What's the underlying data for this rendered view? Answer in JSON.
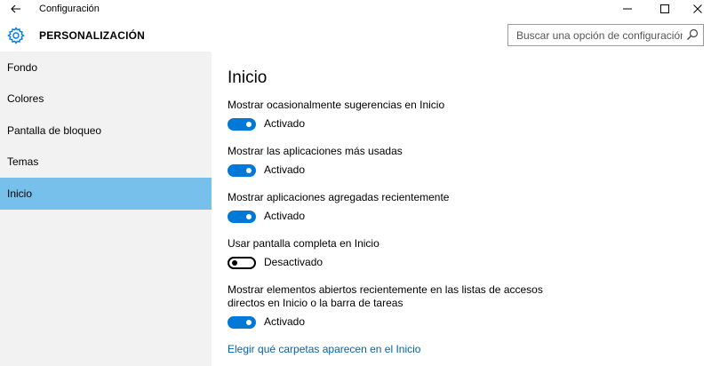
{
  "titlebar": {
    "app_title": "Configuración",
    "icons": {
      "back": "back-arrow-icon",
      "minimize": "minimize-icon",
      "maximize": "maximize-icon",
      "close": "close-icon"
    }
  },
  "header": {
    "section_title": "PERSONALIZACIÓN",
    "section_icon": "gear-icon",
    "search_placeholder": "Buscar una opción de configuración",
    "search_icon": "search-icon"
  },
  "sidebar": {
    "items": [
      {
        "label": "Fondo",
        "selected": false
      },
      {
        "label": "Colores",
        "selected": false
      },
      {
        "label": "Pantalla de bloqueo",
        "selected": false
      },
      {
        "label": "Temas",
        "selected": false
      },
      {
        "label": "Inicio",
        "selected": true
      }
    ]
  },
  "main": {
    "title": "Inicio",
    "settings": [
      {
        "label": "Mostrar ocasionalmente sugerencias en Inicio",
        "state": "Activado",
        "on": true
      },
      {
        "label": "Mostrar las aplicaciones más usadas",
        "state": "Activado",
        "on": true
      },
      {
        "label": "Mostrar aplicaciones agregadas recientemente",
        "state": "Activado",
        "on": true
      },
      {
        "label": "Usar pantalla completa en Inicio",
        "state": "Desactivado",
        "on": false
      },
      {
        "label_line1": "Mostrar elementos abiertos recientemente en las listas de accesos",
        "label_line2": "directos en Inicio o la barra de tareas",
        "state": "Activado",
        "on": true
      }
    ],
    "link": "Elegir qué carpetas aparecen en el Inicio"
  },
  "colors": {
    "accent": "#0078d7",
    "selected_nav": "#78c0ec",
    "sidebar_bg": "#f2f2f2",
    "link": "#0063b1"
  }
}
